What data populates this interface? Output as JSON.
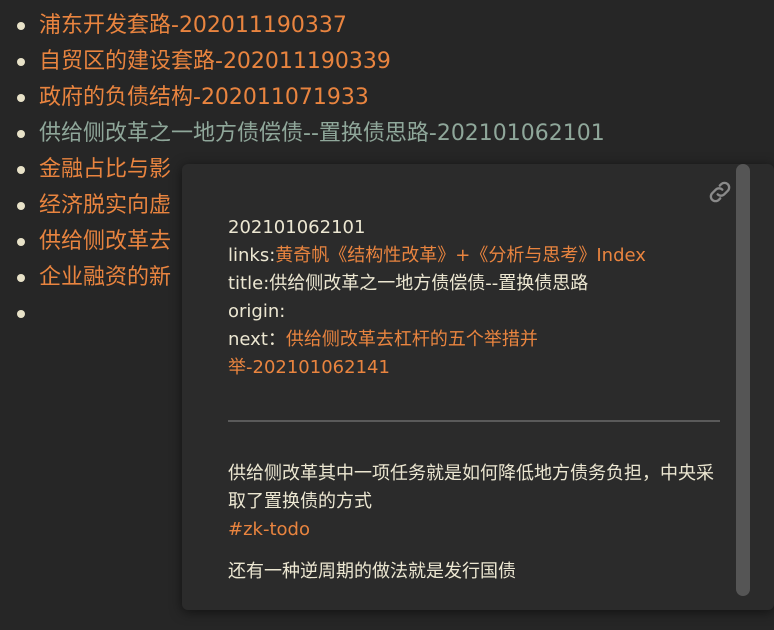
{
  "notes": [
    {
      "label": "浦东开发套路-202011190337"
    },
    {
      "label": "自贸区的建设套路-202011190339"
    },
    {
      "label": "政府的负债结构-202011071933"
    },
    {
      "label": "供给侧改革之一地方债偿债--置换债思路-202101062101"
    },
    {
      "label": "金融占比与影"
    },
    {
      "label": "经济脱实向虚"
    },
    {
      "label": "供给侧改革去"
    },
    {
      "label": "企业融资的新"
    },
    {
      "label": ""
    }
  ],
  "popover": {
    "icon": "link-icon",
    "id_line": "202101062101",
    "links_prefix": "links:",
    "links_value": "黄奇帆《结构性改革》+《分析与思考》Index",
    "title_line": "title:供给侧改革之一地方债偿债--置换债思路",
    "origin_line": "origin:",
    "next_prefix": "next：",
    "next_value": "供给侧改革去杠杆的五个举措并举-202101062141",
    "body_line1": "供给侧改革其中一项任务就是如何降低地方债务负担，中央采取了置换债的方式",
    "tag": "#zk-todo",
    "body_line2": "还有一种逆周期的做法就是发行国债"
  },
  "colors": {
    "background": "#262626",
    "link": "#e9843f",
    "visited_link": "#8fa79a",
    "text": "#ece7d2"
  }
}
